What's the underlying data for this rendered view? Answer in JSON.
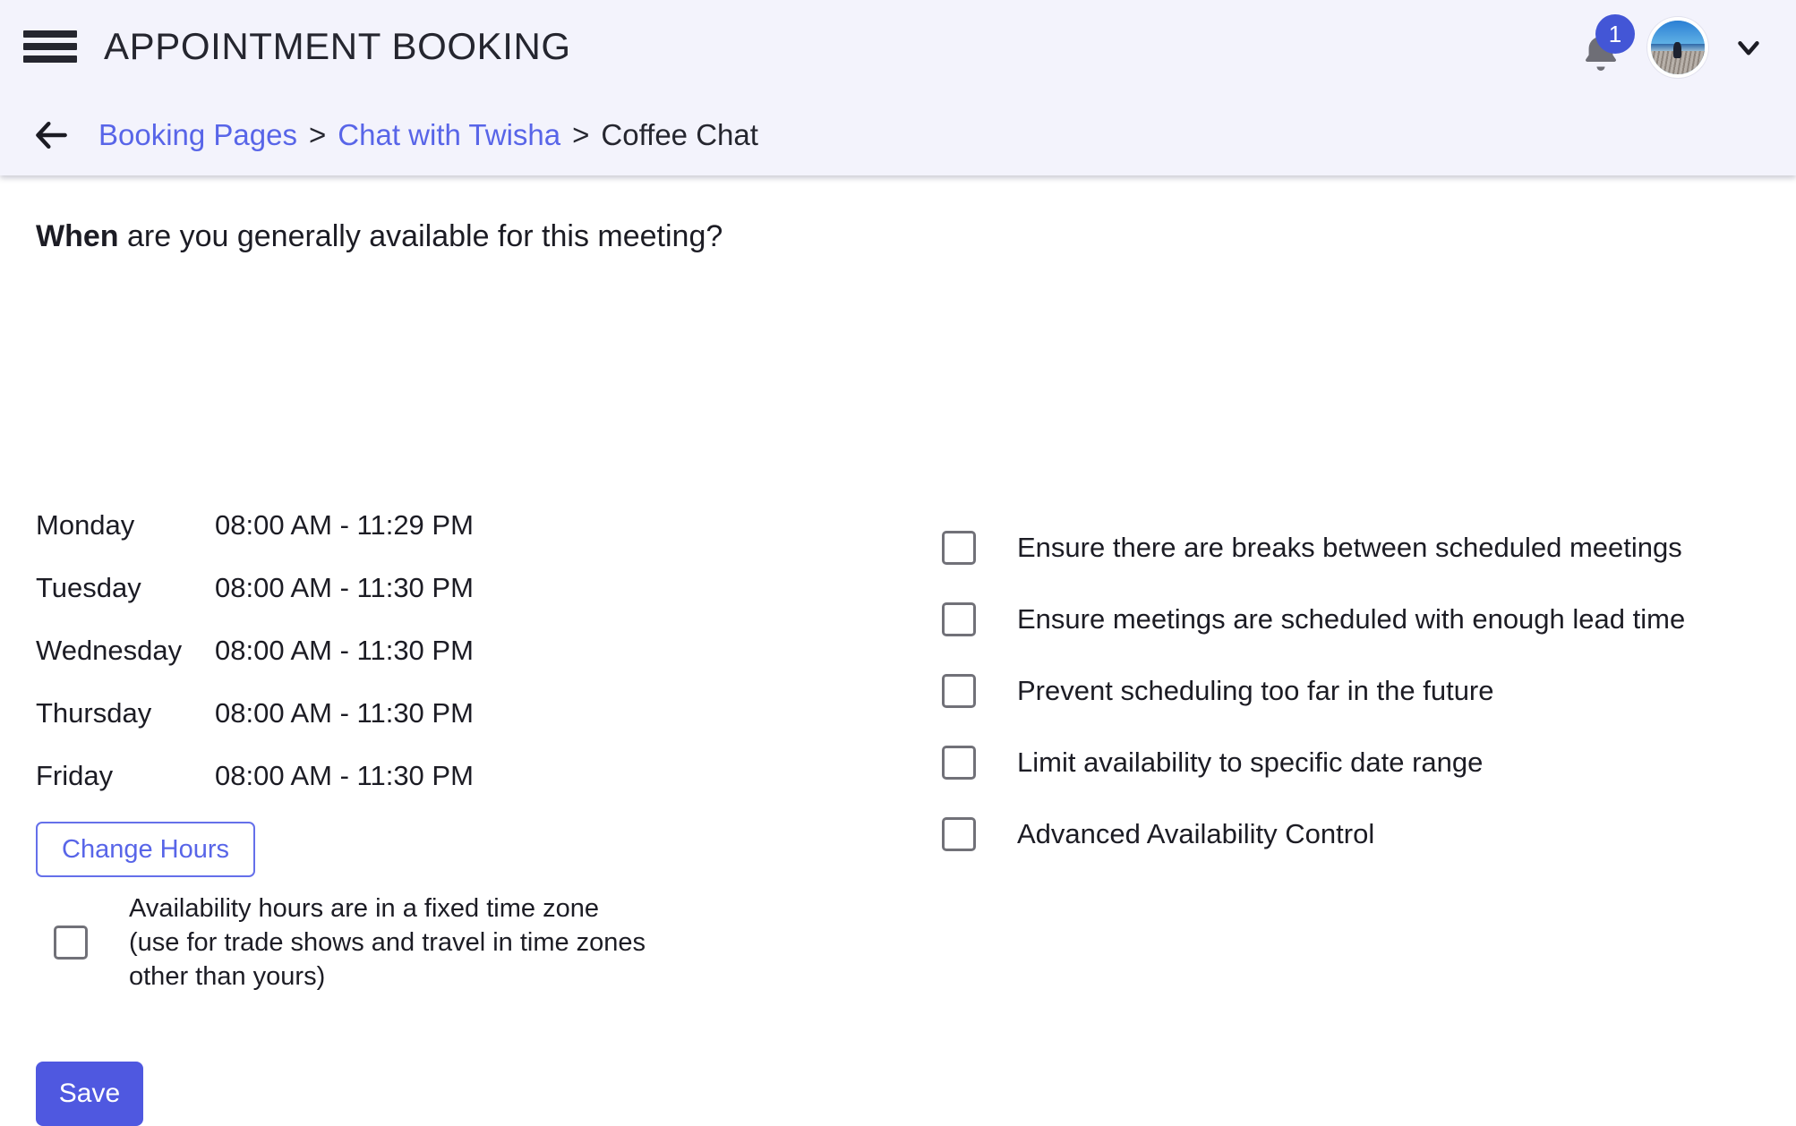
{
  "header": {
    "menu_icon": "hamburger-menu-icon",
    "title": "APPOINTMENT BOOKING",
    "bell_icon": "notification-bell-icon",
    "notification_count": "1",
    "avatar_icon": "user-avatar",
    "chevron_icon": "chevron-down-icon"
  },
  "breadcrumb": {
    "back_icon": "arrow-left-icon",
    "items": [
      {
        "label": "Booking Pages",
        "type": "link"
      },
      {
        "label": "Chat with Twisha",
        "type": "link"
      },
      {
        "label": "Coffee Chat",
        "type": "current"
      }
    ],
    "separator": ">"
  },
  "main": {
    "question_strong": "When",
    "question_rest": " are you generally available for this meeting?",
    "schedule": [
      {
        "day": "Monday",
        "hours": "08:00 AM - 11:29 PM"
      },
      {
        "day": "Tuesday",
        "hours": "08:00 AM - 11:30 PM"
      },
      {
        "day": "Wednesday",
        "hours": "08:00 AM - 11:30 PM"
      },
      {
        "day": "Thursday",
        "hours": "08:00 AM - 11:30 PM"
      },
      {
        "day": "Friday",
        "hours": "08:00 AM - 11:30 PM"
      }
    ],
    "change_hours_label": "Change Hours",
    "fixed_timezone": {
      "line1": "Availability hours are in a fixed time zone",
      "line2": "(use for trade shows and travel in time zones",
      "line3": "other than yours)",
      "checked": false
    },
    "save_label": "Save",
    "options": [
      {
        "label": "Ensure there are breaks between scheduled meetings",
        "checked": false
      },
      {
        "label": "Ensure meetings are scheduled with enough lead time",
        "checked": false
      },
      {
        "label": "Prevent scheduling too far in the future",
        "checked": false
      },
      {
        "label": "Limit availability to specific date range",
        "checked": false
      },
      {
        "label": "Advanced Availability Control",
        "checked": false
      }
    ]
  },
  "colors": {
    "header_bg": "#f3f3fc",
    "accent": "#5865e8",
    "primary_button": "#4f58e0",
    "text": "#1c1c24",
    "badge": "#4356d6",
    "checkbox_border": "#717178"
  }
}
